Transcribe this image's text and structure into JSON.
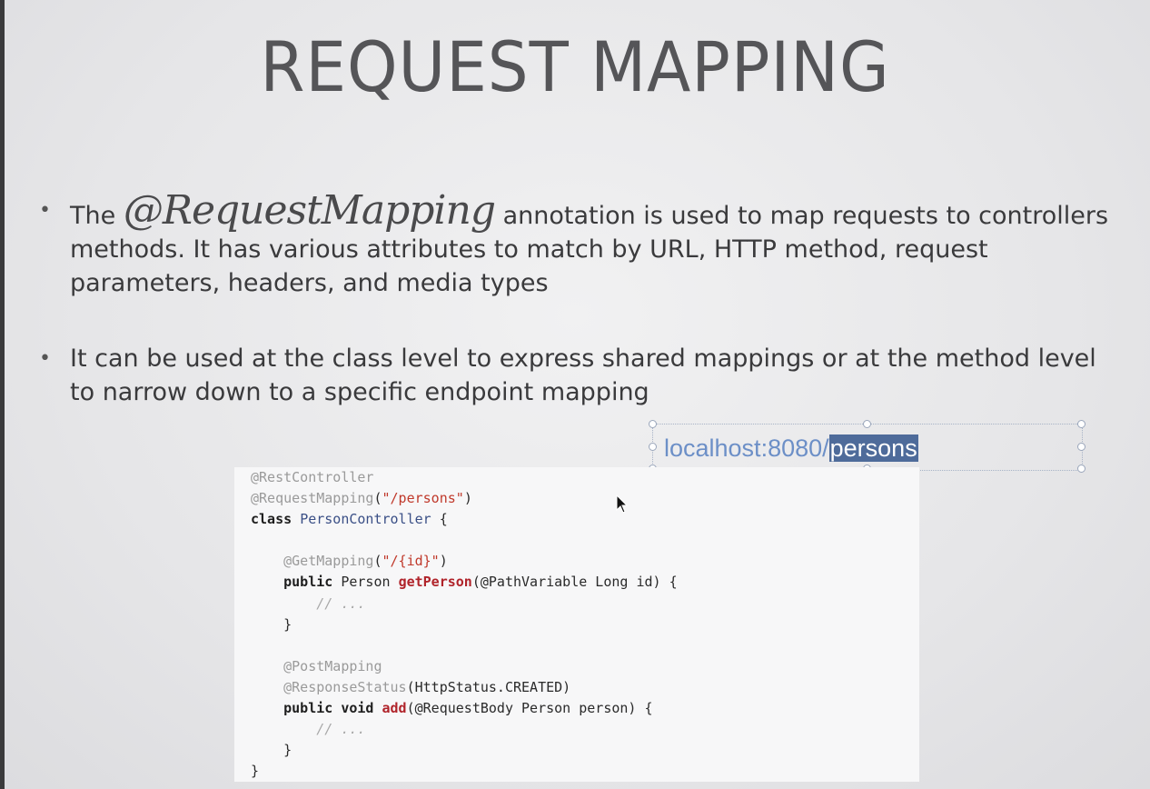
{
  "slide": {
    "title": "REQUEST MAPPING",
    "bullets": [
      {
        "prefix": "The ",
        "annotation": "@RequestMapping",
        "text": " annotation is used to map requests to controllers methods. It has various attributes to match by URL, HTTP method, request parameters, headers, and media types"
      },
      {
        "text": "It can be used at the class level to express shared mappings or at the method level to narrow down to a specific endpoint mapping"
      }
    ]
  },
  "url_box": {
    "prefix": "localhost:8080/",
    "selected": "persons"
  },
  "code": {
    "line1": "@RestController",
    "line2_ann": "@RequestMapping",
    "line2_str": "\"/persons\"",
    "line3_kw": "class",
    "line3_cls": "PersonController",
    "line5_ann": "@GetMapping",
    "line5_str": "\"/{id}\"",
    "line6_kw": "public",
    "line6_type": "Person",
    "line6_meth": "getPerson",
    "line6_args": "(@PathVariable Long id) {",
    "comment": "// ...",
    "close": "}",
    "line10_ann": "@PostMapping",
    "line11_ann": "@ResponseStatus",
    "line11_args": "(HttpStatus.CREATED)",
    "line12_kw": "public void",
    "line12_meth": "add",
    "line12_args": "(@RequestBody Person person) {"
  },
  "colors": {
    "title": "#555558",
    "url": "#6c8fc7",
    "selection": "#4e6b9a",
    "string": "#c0392b",
    "method": "#b0232a"
  }
}
